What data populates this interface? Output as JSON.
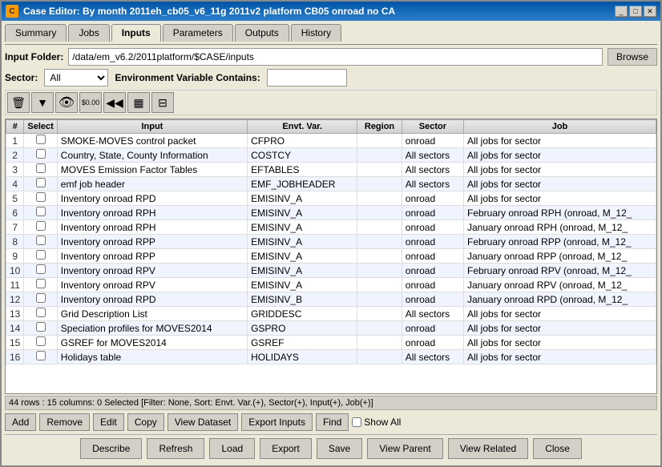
{
  "window": {
    "title": "Case Editor: By month 2011eh_cb05_v6_11g 2011v2 platform CB05 onroad no CA",
    "icon": "C",
    "controls": [
      "minimize",
      "maximize",
      "close"
    ]
  },
  "tabs": [
    {
      "label": "Summary",
      "active": false
    },
    {
      "label": "Jobs",
      "active": false
    },
    {
      "label": "Inputs",
      "active": true
    },
    {
      "label": "Parameters",
      "active": false
    },
    {
      "label": "Outputs",
      "active": false
    },
    {
      "label": "History",
      "active": false
    }
  ],
  "input_folder": {
    "label": "Input Folder:",
    "value": "/data/em_v6.2/2011platform/$CASE/inputs",
    "browse_label": "Browse"
  },
  "sector": {
    "label": "Sector:",
    "value": "All",
    "options": [
      "All"
    ]
  },
  "env_var": {
    "label": "Environment Variable Contains:",
    "value": ""
  },
  "toolbar": {
    "tools": [
      {
        "name": "delete",
        "icon": "🗑"
      },
      {
        "name": "filter",
        "icon": "▼"
      },
      {
        "name": "view",
        "icon": "👁"
      },
      {
        "name": "money",
        "icon": "$0.00"
      },
      {
        "name": "back",
        "icon": "◀◀"
      },
      {
        "name": "grid",
        "icon": "▦"
      },
      {
        "name": "split",
        "icon": "⊟"
      }
    ]
  },
  "table": {
    "columns": [
      "#",
      "Select",
      "Input",
      "Envt. Var.",
      "Region",
      "Sector",
      "Job"
    ],
    "rows": [
      {
        "num": 1,
        "input": "SMOKE-MOVES control packet",
        "envt_var": "CFPRO",
        "region": "",
        "sector": "onroad",
        "job": "All jobs for sector"
      },
      {
        "num": 2,
        "input": "Country, State, County Information",
        "envt_var": "COSTCY",
        "region": "",
        "sector": "All sectors",
        "job": "All jobs for sector"
      },
      {
        "num": 3,
        "input": "MOVES Emission Factor Tables",
        "envt_var": "EFTABLES",
        "region": "",
        "sector": "All sectors",
        "job": "All jobs for sector"
      },
      {
        "num": 4,
        "input": "emf job header",
        "envt_var": "EMF_JOBHEADER",
        "region": "",
        "sector": "All sectors",
        "job": "All jobs for sector"
      },
      {
        "num": 5,
        "input": "Inventory onroad RPD",
        "envt_var": "EMISINV_A",
        "region": "",
        "sector": "onroad",
        "job": "All jobs for sector"
      },
      {
        "num": 6,
        "input": "Inventory onroad RPH",
        "envt_var": "EMISINV_A",
        "region": "",
        "sector": "onroad",
        "job": "February onroad RPH (onroad, M_12_"
      },
      {
        "num": 7,
        "input": "Inventory onroad RPH",
        "envt_var": "EMISINV_A",
        "region": "",
        "sector": "onroad",
        "job": "January onroad RPH (onroad, M_12_"
      },
      {
        "num": 8,
        "input": "Inventory onroad RPP",
        "envt_var": "EMISINV_A",
        "region": "",
        "sector": "onroad",
        "job": "February onroad RPP (onroad, M_12_"
      },
      {
        "num": 9,
        "input": "Inventory onroad RPP",
        "envt_var": "EMISINV_A",
        "region": "",
        "sector": "onroad",
        "job": "January onroad RPP (onroad, M_12_"
      },
      {
        "num": 10,
        "input": "Inventory onroad RPV",
        "envt_var": "EMISINV_A",
        "region": "",
        "sector": "onroad",
        "job": "February onroad RPV (onroad, M_12_"
      },
      {
        "num": 11,
        "input": "Inventory onroad RPV",
        "envt_var": "EMISINV_A",
        "region": "",
        "sector": "onroad",
        "job": "January onroad RPV (onroad, M_12_"
      },
      {
        "num": 12,
        "input": "Inventory onroad RPD",
        "envt_var": "EMISINV_B",
        "region": "",
        "sector": "onroad",
        "job": "January onroad RPD (onroad, M_12_"
      },
      {
        "num": 13,
        "input": "Grid Description List",
        "envt_var": "GRIDDESC",
        "region": "",
        "sector": "All sectors",
        "job": "All jobs for sector"
      },
      {
        "num": 14,
        "input": "Speciation profiles for MOVES2014",
        "envt_var": "GSPRO",
        "region": "",
        "sector": "onroad",
        "job": "All jobs for sector"
      },
      {
        "num": 15,
        "input": "GSREF for MOVES2014",
        "envt_var": "GSREF",
        "region": "",
        "sector": "onroad",
        "job": "All jobs for sector"
      },
      {
        "num": 16,
        "input": "Holidays table",
        "envt_var": "HOLIDAYS",
        "region": "",
        "sector": "All sectors",
        "job": "All jobs for sector"
      }
    ]
  },
  "status": "44 rows : 15 columns: 0 Selected [Filter: None, Sort: Envt. Var.(+), Sector(+), Input(+), Job(+)]",
  "action_buttons": {
    "add": "Add",
    "remove": "Remove",
    "edit": "Edit",
    "copy": "Copy",
    "view_dataset": "View Dataset",
    "export_inputs": "Export Inputs",
    "find": "Find",
    "show_all": "Show All"
  },
  "bottom_buttons": {
    "describe": "Describe",
    "refresh": "Refresh",
    "load": "Load",
    "export": "Export",
    "save": "Save",
    "view_parent": "View Parent",
    "view_related": "View Related",
    "close": "Close"
  }
}
